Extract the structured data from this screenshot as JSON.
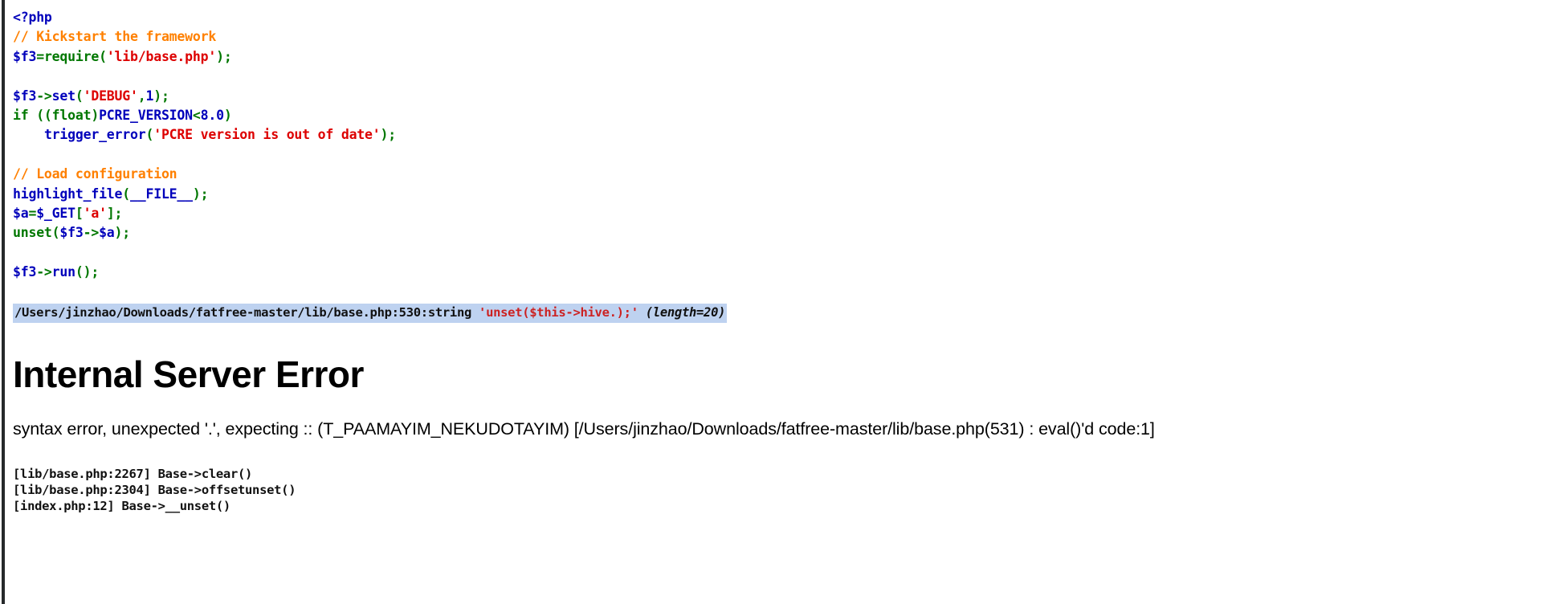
{
  "page": {
    "title": "Internal Server Error",
    "background_color": "#ffffff",
    "window_edge_color": "#26292b"
  },
  "source": {
    "description": "highlight_file(__FILE__) output of index.php",
    "colors": {
      "keyword": "#007700",
      "variable": "#0000bb",
      "string": "#dd0000",
      "comment": "#ff8000",
      "default": "#0000bb"
    },
    "lines": [
      [
        {
          "t": "<?php",
          "c": "def"
        }
      ],
      [
        {
          "t": "// Kickstart the framework",
          "c": "cmt"
        }
      ],
      [
        {
          "t": "$f3",
          "c": "var"
        },
        {
          "t": "=",
          "c": "kw"
        },
        {
          "t": "require",
          "c": "kw"
        },
        {
          "t": "(",
          "c": "kw"
        },
        {
          "t": "'lib/base.php'",
          "c": "str"
        },
        {
          "t": ");",
          "c": "kw"
        }
      ],
      [
        {
          "t": "",
          "c": "def"
        }
      ],
      [
        {
          "t": "$f3",
          "c": "var"
        },
        {
          "t": "->",
          "c": "kw"
        },
        {
          "t": "set",
          "c": "var"
        },
        {
          "t": "(",
          "c": "kw"
        },
        {
          "t": "'DEBUG'",
          "c": "str"
        },
        {
          "t": ",",
          "c": "kw"
        },
        {
          "t": "1",
          "c": "var"
        },
        {
          "t": ");",
          "c": "kw"
        }
      ],
      [
        {
          "t": "if ",
          "c": "kw"
        },
        {
          "t": "((",
          "c": "kw"
        },
        {
          "t": "float",
          "c": "kw"
        },
        {
          "t": ")",
          "c": "kw"
        },
        {
          "t": "PCRE_VERSION",
          "c": "var"
        },
        {
          "t": "<",
          "c": "kw"
        },
        {
          "t": "8.0",
          "c": "var"
        },
        {
          "t": ")",
          "c": "kw"
        }
      ],
      [
        {
          "t": "    ",
          "c": "def"
        },
        {
          "t": "trigger_error",
          "c": "var"
        },
        {
          "t": "(",
          "c": "kw"
        },
        {
          "t": "'PCRE version is out of date'",
          "c": "str"
        },
        {
          "t": ");",
          "c": "kw"
        }
      ],
      [
        {
          "t": "",
          "c": "def"
        }
      ],
      [
        {
          "t": "// Load configuration",
          "c": "cmt"
        }
      ],
      [
        {
          "t": "highlight_file",
          "c": "var"
        },
        {
          "t": "(",
          "c": "kw"
        },
        {
          "t": "__FILE__",
          "c": "var"
        },
        {
          "t": ");",
          "c": "kw"
        }
      ],
      [
        {
          "t": "$a",
          "c": "var"
        },
        {
          "t": "=",
          "c": "kw"
        },
        {
          "t": "$_GET",
          "c": "var"
        },
        {
          "t": "[",
          "c": "kw"
        },
        {
          "t": "'a'",
          "c": "str"
        },
        {
          "t": "];",
          "c": "kw"
        }
      ],
      [
        {
          "t": "unset",
          "c": "kw"
        },
        {
          "t": "(",
          "c": "kw"
        },
        {
          "t": "$f3",
          "c": "var"
        },
        {
          "t": "->",
          "c": "kw"
        },
        {
          "t": "$a",
          "c": "var"
        },
        {
          "t": ");",
          "c": "kw"
        }
      ],
      [
        {
          "t": "",
          "c": "def"
        }
      ],
      [
        {
          "t": "$f3",
          "c": "var"
        },
        {
          "t": "->",
          "c": "kw"
        },
        {
          "t": "run",
          "c": "var"
        },
        {
          "t": "(",
          "c": "kw"
        },
        {
          "t": ");",
          "c": "kw"
        }
      ]
    ]
  },
  "var_dump": {
    "location": "/Users/jinzhao/Downloads/fatfree-master/lib/base.php:530:string ",
    "value": "'unset($this->hive.);'",
    "length_note": " (length=20)",
    "highlight_color": "#bed2f0",
    "string_color": "#cc2222"
  },
  "error": {
    "heading": "Internal Server Error",
    "message": "syntax error, unexpected '.', expecting :: (T_PAAMAYIM_NEKUDOTAYIM) [/Users/jinzhao/Downloads/fatfree-master/lib/base.php(531) : eval()'d code:1]"
  },
  "stack_trace": {
    "lines": [
      "[lib/base.php:2267] Base->clear()",
      "[lib/base.php:2304] Base->offsetunset()",
      "[index.php:12] Base->__unset()"
    ]
  }
}
